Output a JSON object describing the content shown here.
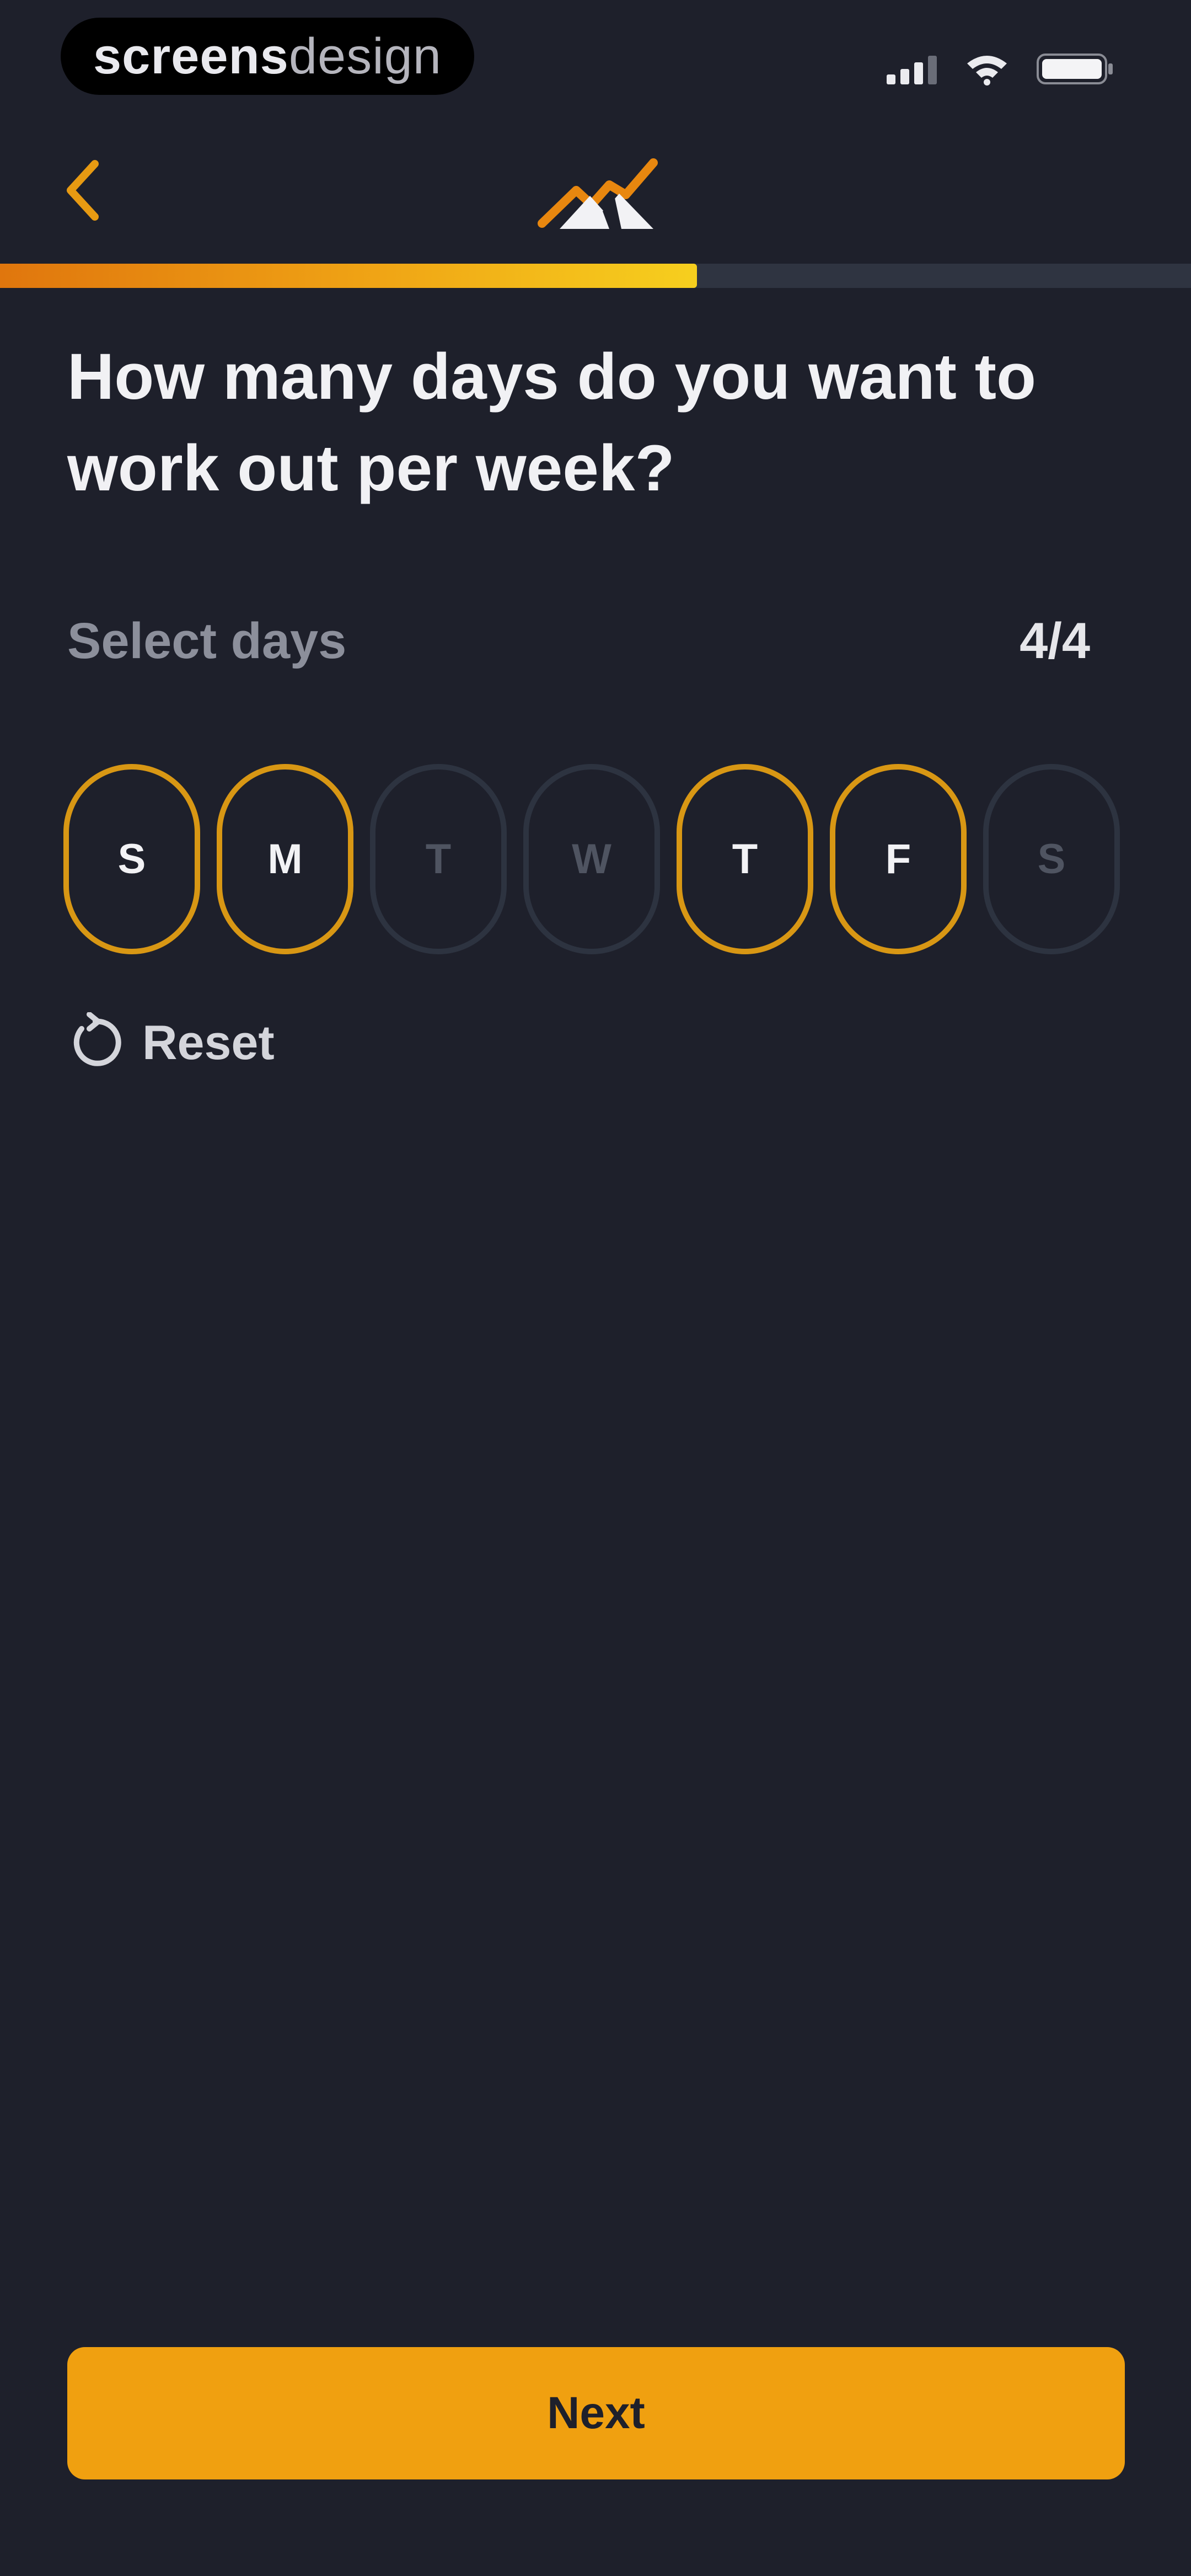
{
  "status_bar": {
    "brand_bold": "screens",
    "brand_light": "design",
    "icons": [
      "signal-icon",
      "wifi-icon",
      "battery-icon"
    ]
  },
  "header": {
    "back_icon": "chevron-left-icon",
    "logo_icon": "mountain-logo-icon"
  },
  "progress": {
    "fraction": 0.585,
    "colors": {
      "start": "#e0760d",
      "end": "#f6cf1e",
      "track": "#2f3441"
    }
  },
  "question": "How many days do you want to work out per week?",
  "selection": {
    "label": "Select days",
    "count": "4/4"
  },
  "days": [
    {
      "letter": "S",
      "selected": true
    },
    {
      "letter": "M",
      "selected": true
    },
    {
      "letter": "T",
      "selected": false
    },
    {
      "letter": "W",
      "selected": false
    },
    {
      "letter": "T",
      "selected": true
    },
    {
      "letter": "F",
      "selected": true
    },
    {
      "letter": "S",
      "selected": false
    }
  ],
  "reset": {
    "label": "Reset",
    "icon": "reset-icon"
  },
  "next_button": {
    "label": "Next"
  },
  "colors": {
    "background": "#1e202b",
    "accent": "#f0a010",
    "selected_border": "#d89714",
    "unselected_border": "#2d3340"
  }
}
